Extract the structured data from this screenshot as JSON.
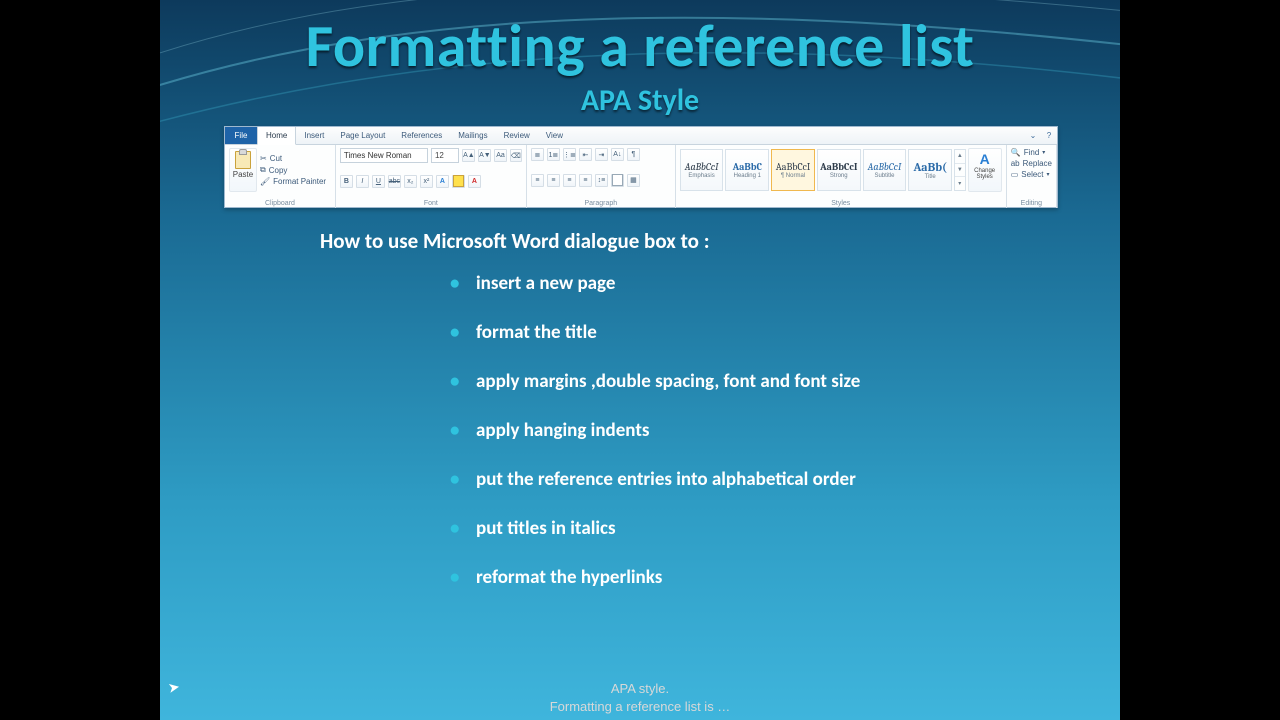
{
  "slide": {
    "title": "Formatting a reference list",
    "subtitle": "APA Style",
    "intro": "How to use Microsoft Word dialogue box to :",
    "bullets": [
      "insert a new page",
      "format the title",
      "apply margins ,double spacing, font and font size",
      "apply hanging indents",
      "put the reference entries into alphabetical order",
      "put titles in italics",
      "reformat the hyperlinks"
    ]
  },
  "ribbon": {
    "file_tab": "File",
    "tabs": [
      "Home",
      "Insert",
      "Page Layout",
      "References",
      "Mailings",
      "Review",
      "View"
    ],
    "active_tab": "Home",
    "paste_label": "Paste",
    "clipboard_group": "Clipboard",
    "cut": "Cut",
    "copy": "Copy",
    "format_painter": "Format Painter",
    "font_name": "Times New Roman",
    "font_size": "12",
    "font_group": "Font",
    "paragraph_group": "Paragraph",
    "styles_group": "Styles",
    "editing_group": "Editing",
    "styles": [
      {
        "sample": "AaBbCcI",
        "name": "Emphasis"
      },
      {
        "sample": "AaBbC",
        "name": "Heading 1"
      },
      {
        "sample": "AaBbCcI",
        "name": "¶ Normal"
      },
      {
        "sample": "AaBbCcI",
        "name": "Strong"
      },
      {
        "sample": "AaBbCcI",
        "name": "Subtitle"
      },
      {
        "sample": "AaBb(",
        "name": "Title"
      }
    ],
    "change_styles": "Change Styles",
    "find": "Find",
    "replace": "Replace",
    "select": "Select"
  },
  "caption": {
    "line1": "APA style.",
    "line2": "Formatting a reference list is …"
  }
}
